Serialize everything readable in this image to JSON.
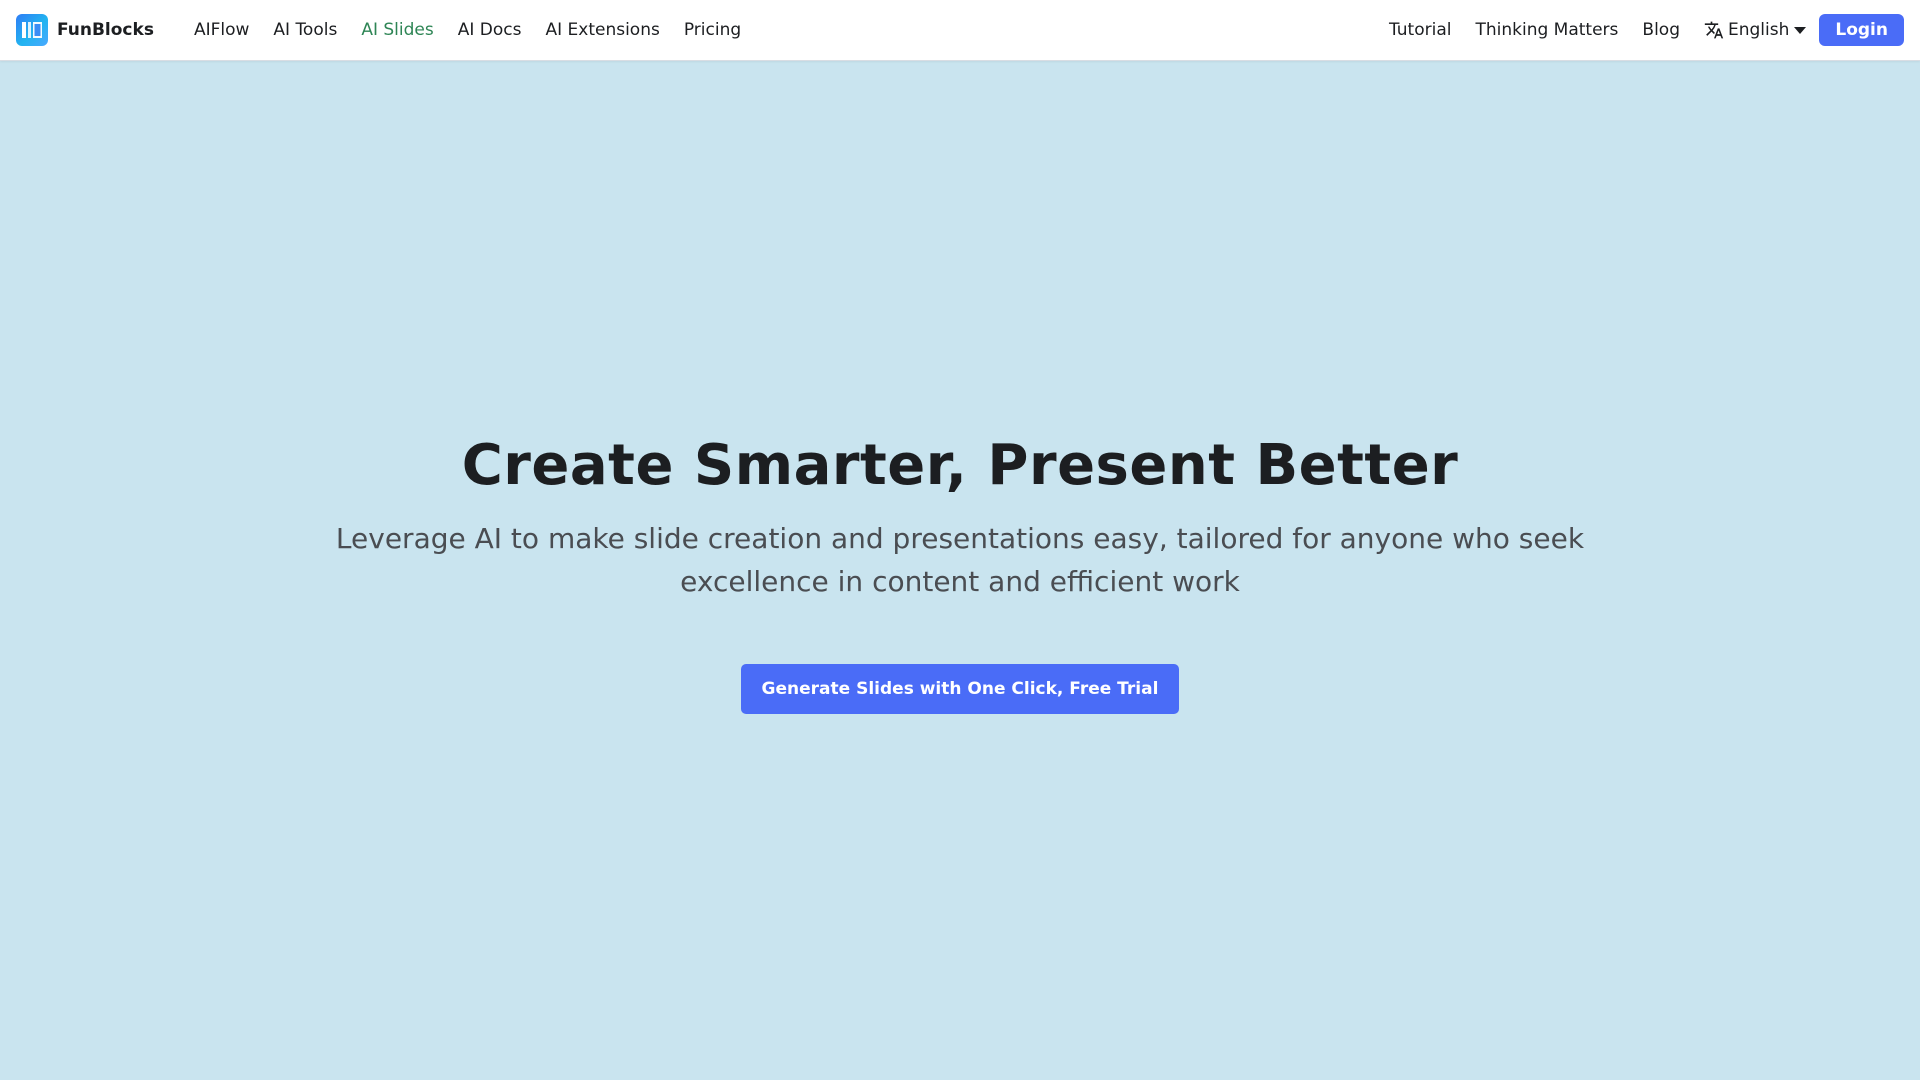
{
  "brand": {
    "name": "FunBlocks",
    "logo_icon": "funblocks-logo-icon"
  },
  "nav": {
    "left_items": [
      {
        "label": "AIFlow",
        "active": false
      },
      {
        "label": "AI Tools",
        "active": false
      },
      {
        "label": "AI Slides",
        "active": true
      },
      {
        "label": "AI Docs",
        "active": false
      },
      {
        "label": "AI Extensions",
        "active": false
      },
      {
        "label": "Pricing",
        "active": false
      }
    ],
    "right_items": [
      {
        "label": "Tutorial"
      },
      {
        "label": "Thinking Matters"
      },
      {
        "label": "Blog"
      }
    ],
    "language": {
      "label": "English",
      "icon": "translate-icon"
    },
    "login_label": "Login"
  },
  "hero": {
    "title": "Create Smarter, Present Better",
    "subtitle": "Leverage AI to make slide creation and presentations easy, tailored for anyone who seek excellence in content and efficient work",
    "cta_label": "Generate Slides with One Click, Free Trial"
  },
  "colors": {
    "background": "#c9e4ef",
    "accent": "#4a6cf7",
    "active_link": "#2e8555"
  }
}
